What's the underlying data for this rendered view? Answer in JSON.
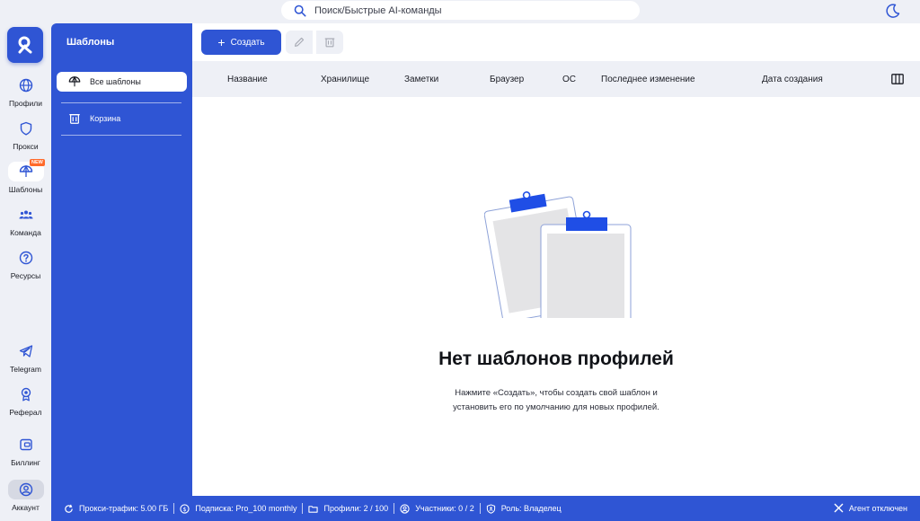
{
  "search": {
    "placeholder": "Поиск/Быстрые AI-команды"
  },
  "rail": {
    "items": [
      {
        "label": "Профили",
        "icon": "globe-icon"
      },
      {
        "label": "Прокси",
        "icon": "shield-icon"
      },
      {
        "label": "Шаблоны",
        "icon": "umbrella-icon",
        "badge": "NEW"
      },
      {
        "label": "Команда",
        "icon": "team-icon"
      },
      {
        "label": "Ресурсы",
        "icon": "help-icon"
      },
      {
        "label": "Telegram",
        "icon": "telegram-icon"
      },
      {
        "label": "Реферал",
        "icon": "award-icon"
      },
      {
        "label": "Биллинг",
        "icon": "wallet-icon"
      },
      {
        "label": "Аккаунт",
        "icon": "account-icon"
      }
    ]
  },
  "sidebar": {
    "title": "Шаблоны",
    "items": [
      {
        "label": "Все шаблоны",
        "icon": "umbrella-icon"
      },
      {
        "label": "Корзина",
        "icon": "trash-icon"
      }
    ]
  },
  "toolbar": {
    "create_label": "Создать"
  },
  "table": {
    "columns": [
      "Название",
      "Хранилище",
      "Заметки",
      "Браузер",
      "ОС",
      "Последнее изменение",
      "Дата создания"
    ]
  },
  "empty": {
    "title": "Нет шаблонов профилей",
    "line1": "Нажмите «Создать», чтобы создать свой шаблон и",
    "line2": "установить его по умолчанию для новых профилей."
  },
  "status": {
    "proxy_traffic": "Прокси-трафик: 5.00 ГБ",
    "subscription": "Подписка: Pro_100 monthly",
    "profiles": "Профили: 2 / 100",
    "members": "Участники: 0 / 2",
    "role": "Роль: Владелец",
    "agent": "Агент отключен"
  },
  "colors": {
    "accent": "#2f55d4",
    "badge": "#ff6a2b",
    "background": "#eef0f6"
  }
}
